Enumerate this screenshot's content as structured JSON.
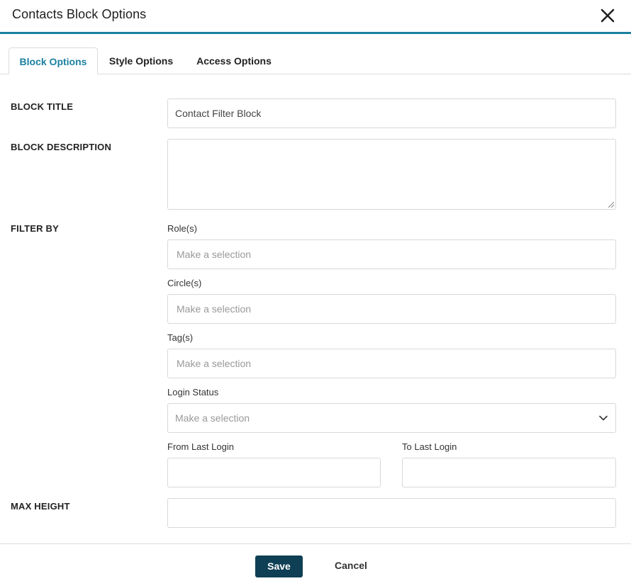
{
  "dialog": {
    "title": "Contacts Block Options"
  },
  "tabs": [
    {
      "label": "Block Options",
      "active": true
    },
    {
      "label": "Style Options",
      "active": false
    },
    {
      "label": "Access Options",
      "active": false
    }
  ],
  "form": {
    "block_title": {
      "label": "BLOCK TITLE",
      "value": "Contact Filter Block"
    },
    "block_description": {
      "label": "BLOCK DESCRIPTION",
      "value": ""
    },
    "filter_by": {
      "label": "FILTER BY",
      "roles": {
        "label": "Role(s)",
        "placeholder": "Make a selection"
      },
      "circles": {
        "label": "Circle(s)",
        "placeholder": "Make a selection"
      },
      "tags": {
        "label": "Tag(s)",
        "placeholder": "Make a selection"
      },
      "login_status": {
        "label": "Login Status",
        "placeholder": "Make a selection"
      },
      "from_last_login": {
        "label": "From Last Login",
        "value": ""
      },
      "to_last_login": {
        "label": "To Last Login",
        "value": ""
      }
    },
    "max_height": {
      "label": "MAX HEIGHT",
      "value": ""
    }
  },
  "footer": {
    "save_label": "Save",
    "cancel_label": "Cancel"
  },
  "colors": {
    "accent": "#1a7fa0",
    "save_button": "#0f3f55"
  },
  "icons": {
    "close": "close-icon",
    "dropdown": "chevron-down-icon"
  }
}
